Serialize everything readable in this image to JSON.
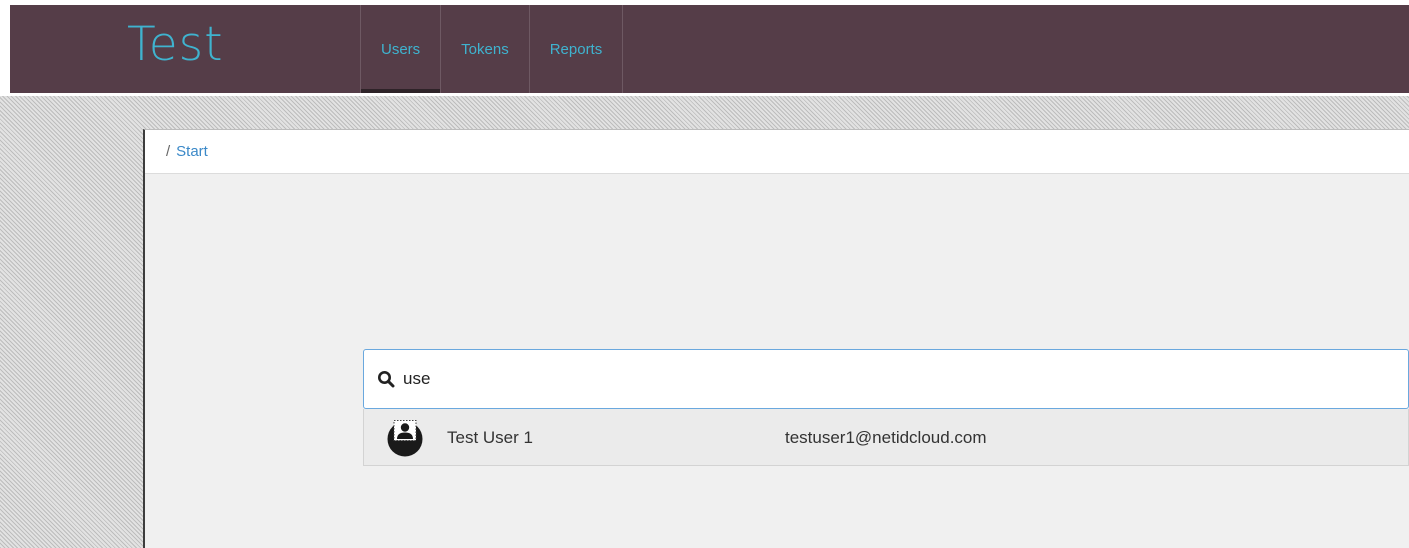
{
  "header": {
    "logo": "Test",
    "tabs": [
      {
        "label": "Users",
        "active": true
      },
      {
        "label": "Tokens",
        "active": false
      },
      {
        "label": "Reports",
        "active": false
      }
    ]
  },
  "breadcrumb": {
    "separator": "/",
    "items": [
      "Start"
    ]
  },
  "search": {
    "icon": "search-icon",
    "value": "use"
  },
  "results": [
    {
      "avatar": "user-avatar-icon",
      "name": "Test User 1",
      "email": "testuser1@netidcloud.com"
    }
  ],
  "colors": {
    "header_bg": "#553d48",
    "accent": "#3fb3cf",
    "link": "#3b89c8",
    "search_border": "#6aa8de"
  }
}
